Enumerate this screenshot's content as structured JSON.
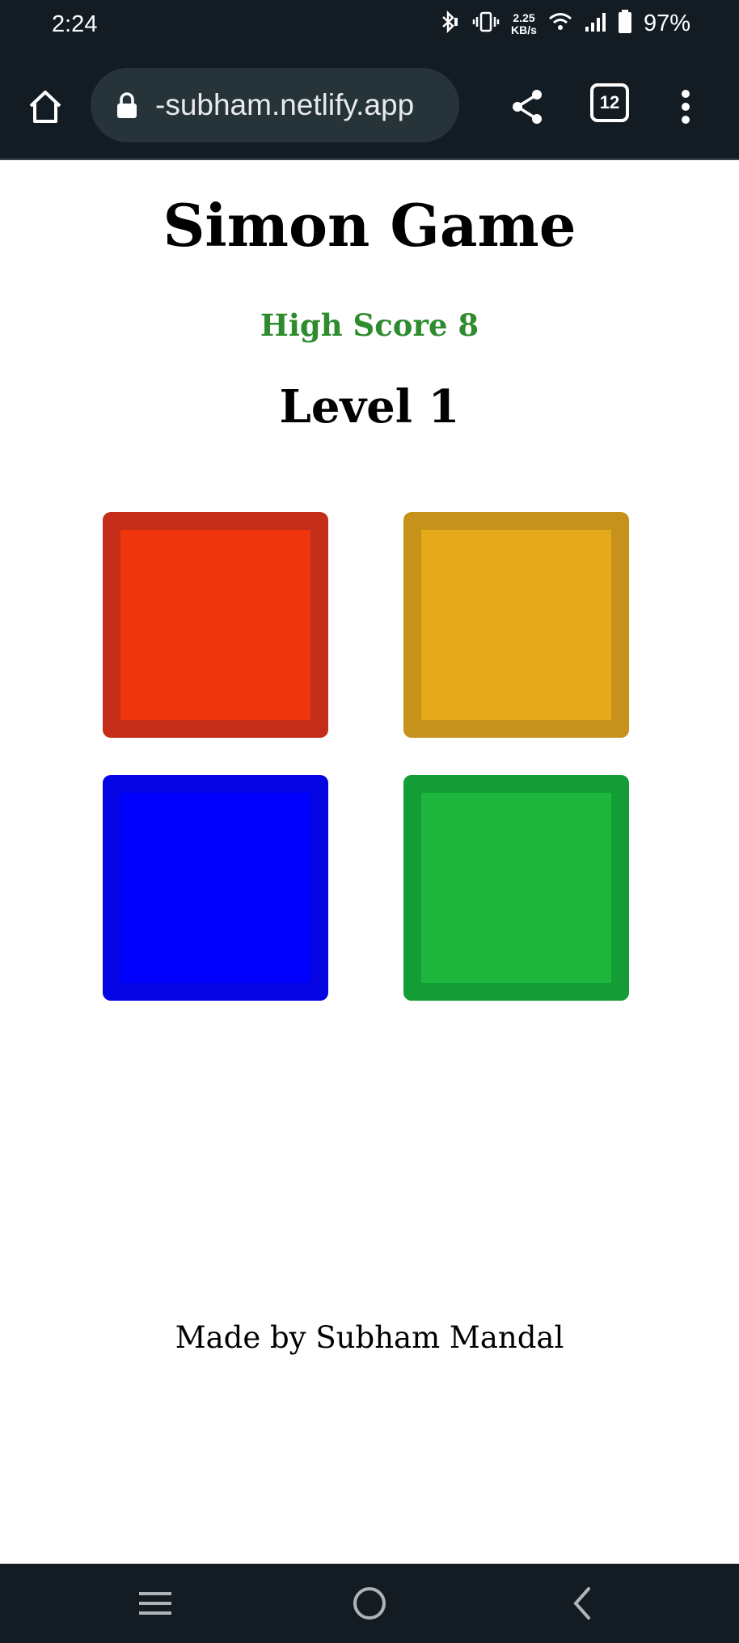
{
  "status_bar": {
    "time": "2:24",
    "net_speed_value": "2.25",
    "net_speed_unit": "KB/s",
    "battery": "97%",
    "icons": [
      "bluetooth-icon",
      "vibrate-icon",
      "wifi-icon",
      "signal-icon",
      "battery-icon"
    ]
  },
  "browser": {
    "url": "-subham.netlify.app",
    "tab_count": "12",
    "icons": [
      "home-icon",
      "lock-icon",
      "share-icon",
      "tabs-icon",
      "more-vert-icon"
    ]
  },
  "game": {
    "title": "Simon Game",
    "high_score": "High Score 8",
    "level": "Level 1",
    "buttons": [
      {
        "name": "red",
        "color": "#ef350c"
      },
      {
        "name": "yellow",
        "color": "#e5aa1a"
      },
      {
        "name": "blue",
        "color": "#0000fe"
      },
      {
        "name": "green",
        "color": "#1db53c"
      }
    ],
    "footer": "Made by Subham Mandal"
  },
  "nav_bar": {
    "icons": [
      "recents-icon",
      "home-circle-icon",
      "back-icon"
    ]
  }
}
